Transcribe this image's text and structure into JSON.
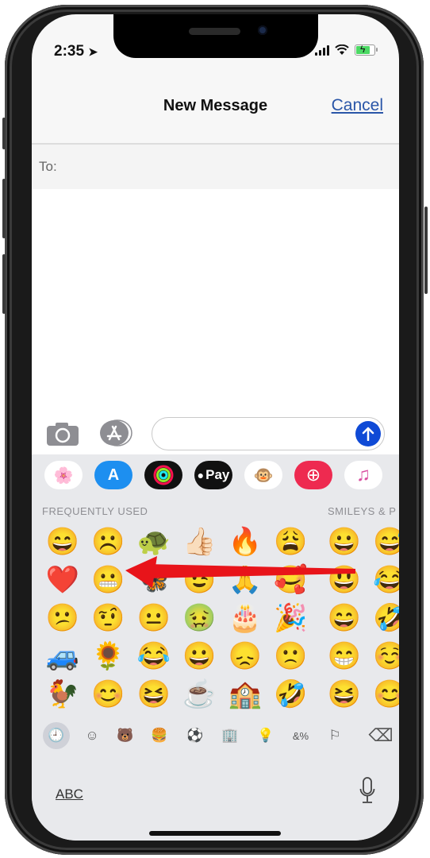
{
  "status_bar": {
    "time": "2:35",
    "location_icon": "location-arrow-icon",
    "signal_icon": "signal-bars-icon",
    "wifi_icon": "wifi-icon",
    "battery_icon": "battery-charging-icon"
  },
  "nav": {
    "title": "New Message",
    "cancel_label": "Cancel"
  },
  "to_field": {
    "label": "To:",
    "value": ""
  },
  "message_input": {
    "value": "",
    "placeholder": ""
  },
  "input_bar": {
    "camera_icon": "camera-icon",
    "apps_icon": "app-store-icon",
    "send_icon": "send-arrow-up-icon"
  },
  "app_strip": [
    {
      "name": "photos",
      "glyph": "🌸"
    },
    {
      "name": "app-store",
      "glyph": "A"
    },
    {
      "name": "activity",
      "glyph": "◎"
    },
    {
      "name": "apple-pay",
      "glyph": "Pay"
    },
    {
      "name": "animoji",
      "glyph": "🐵"
    },
    {
      "name": "search-images",
      "glyph": "⊕"
    },
    {
      "name": "music",
      "glyph": "♫"
    }
  ],
  "sections": {
    "frequently_used": "FREQUENTLY USED",
    "smileys": "SMILEYS & P"
  },
  "frequently_used": [
    "😄",
    "☹️",
    "🐢",
    "👍🏻",
    "🔥",
    "😩",
    "❤️",
    "😬",
    "🦋",
    "😉",
    "🙏",
    "🥰",
    "😕",
    "🤨",
    "😐",
    "🤢",
    "🎂",
    "🎉",
    "🚙",
    "🌻",
    "😂",
    "😀",
    "😞",
    "🙁",
    "🐓",
    "😊",
    "😆",
    "☕",
    "🏫",
    "🤣"
  ],
  "smileys": [
    "😀",
    "😅",
    "😃",
    "😂",
    "😄",
    "🤣",
    "😁",
    "☺️",
    "😆",
    "😊"
  ],
  "categories": [
    {
      "name": "recents",
      "glyph": "🕘",
      "active": true
    },
    {
      "name": "smileys",
      "glyph": "☺"
    },
    {
      "name": "animals",
      "glyph": "🐻"
    },
    {
      "name": "food",
      "glyph": "🍔"
    },
    {
      "name": "activity",
      "glyph": "⚽"
    },
    {
      "name": "travel",
      "glyph": "🏢"
    },
    {
      "name": "objects",
      "glyph": "💡"
    },
    {
      "name": "symbols",
      "glyph": "&%"
    },
    {
      "name": "flags",
      "glyph": "⚐"
    },
    {
      "name": "delete",
      "glyph": "⌫"
    }
  ],
  "abc_label": "ABC",
  "annotation": {
    "type": "arrow",
    "color": "#e8141a",
    "points_to": "heart-emoji"
  },
  "colors": {
    "accent": "#2a56a8",
    "send": "#0f4ad6",
    "keyboard_bg": "#e8e9ec"
  }
}
